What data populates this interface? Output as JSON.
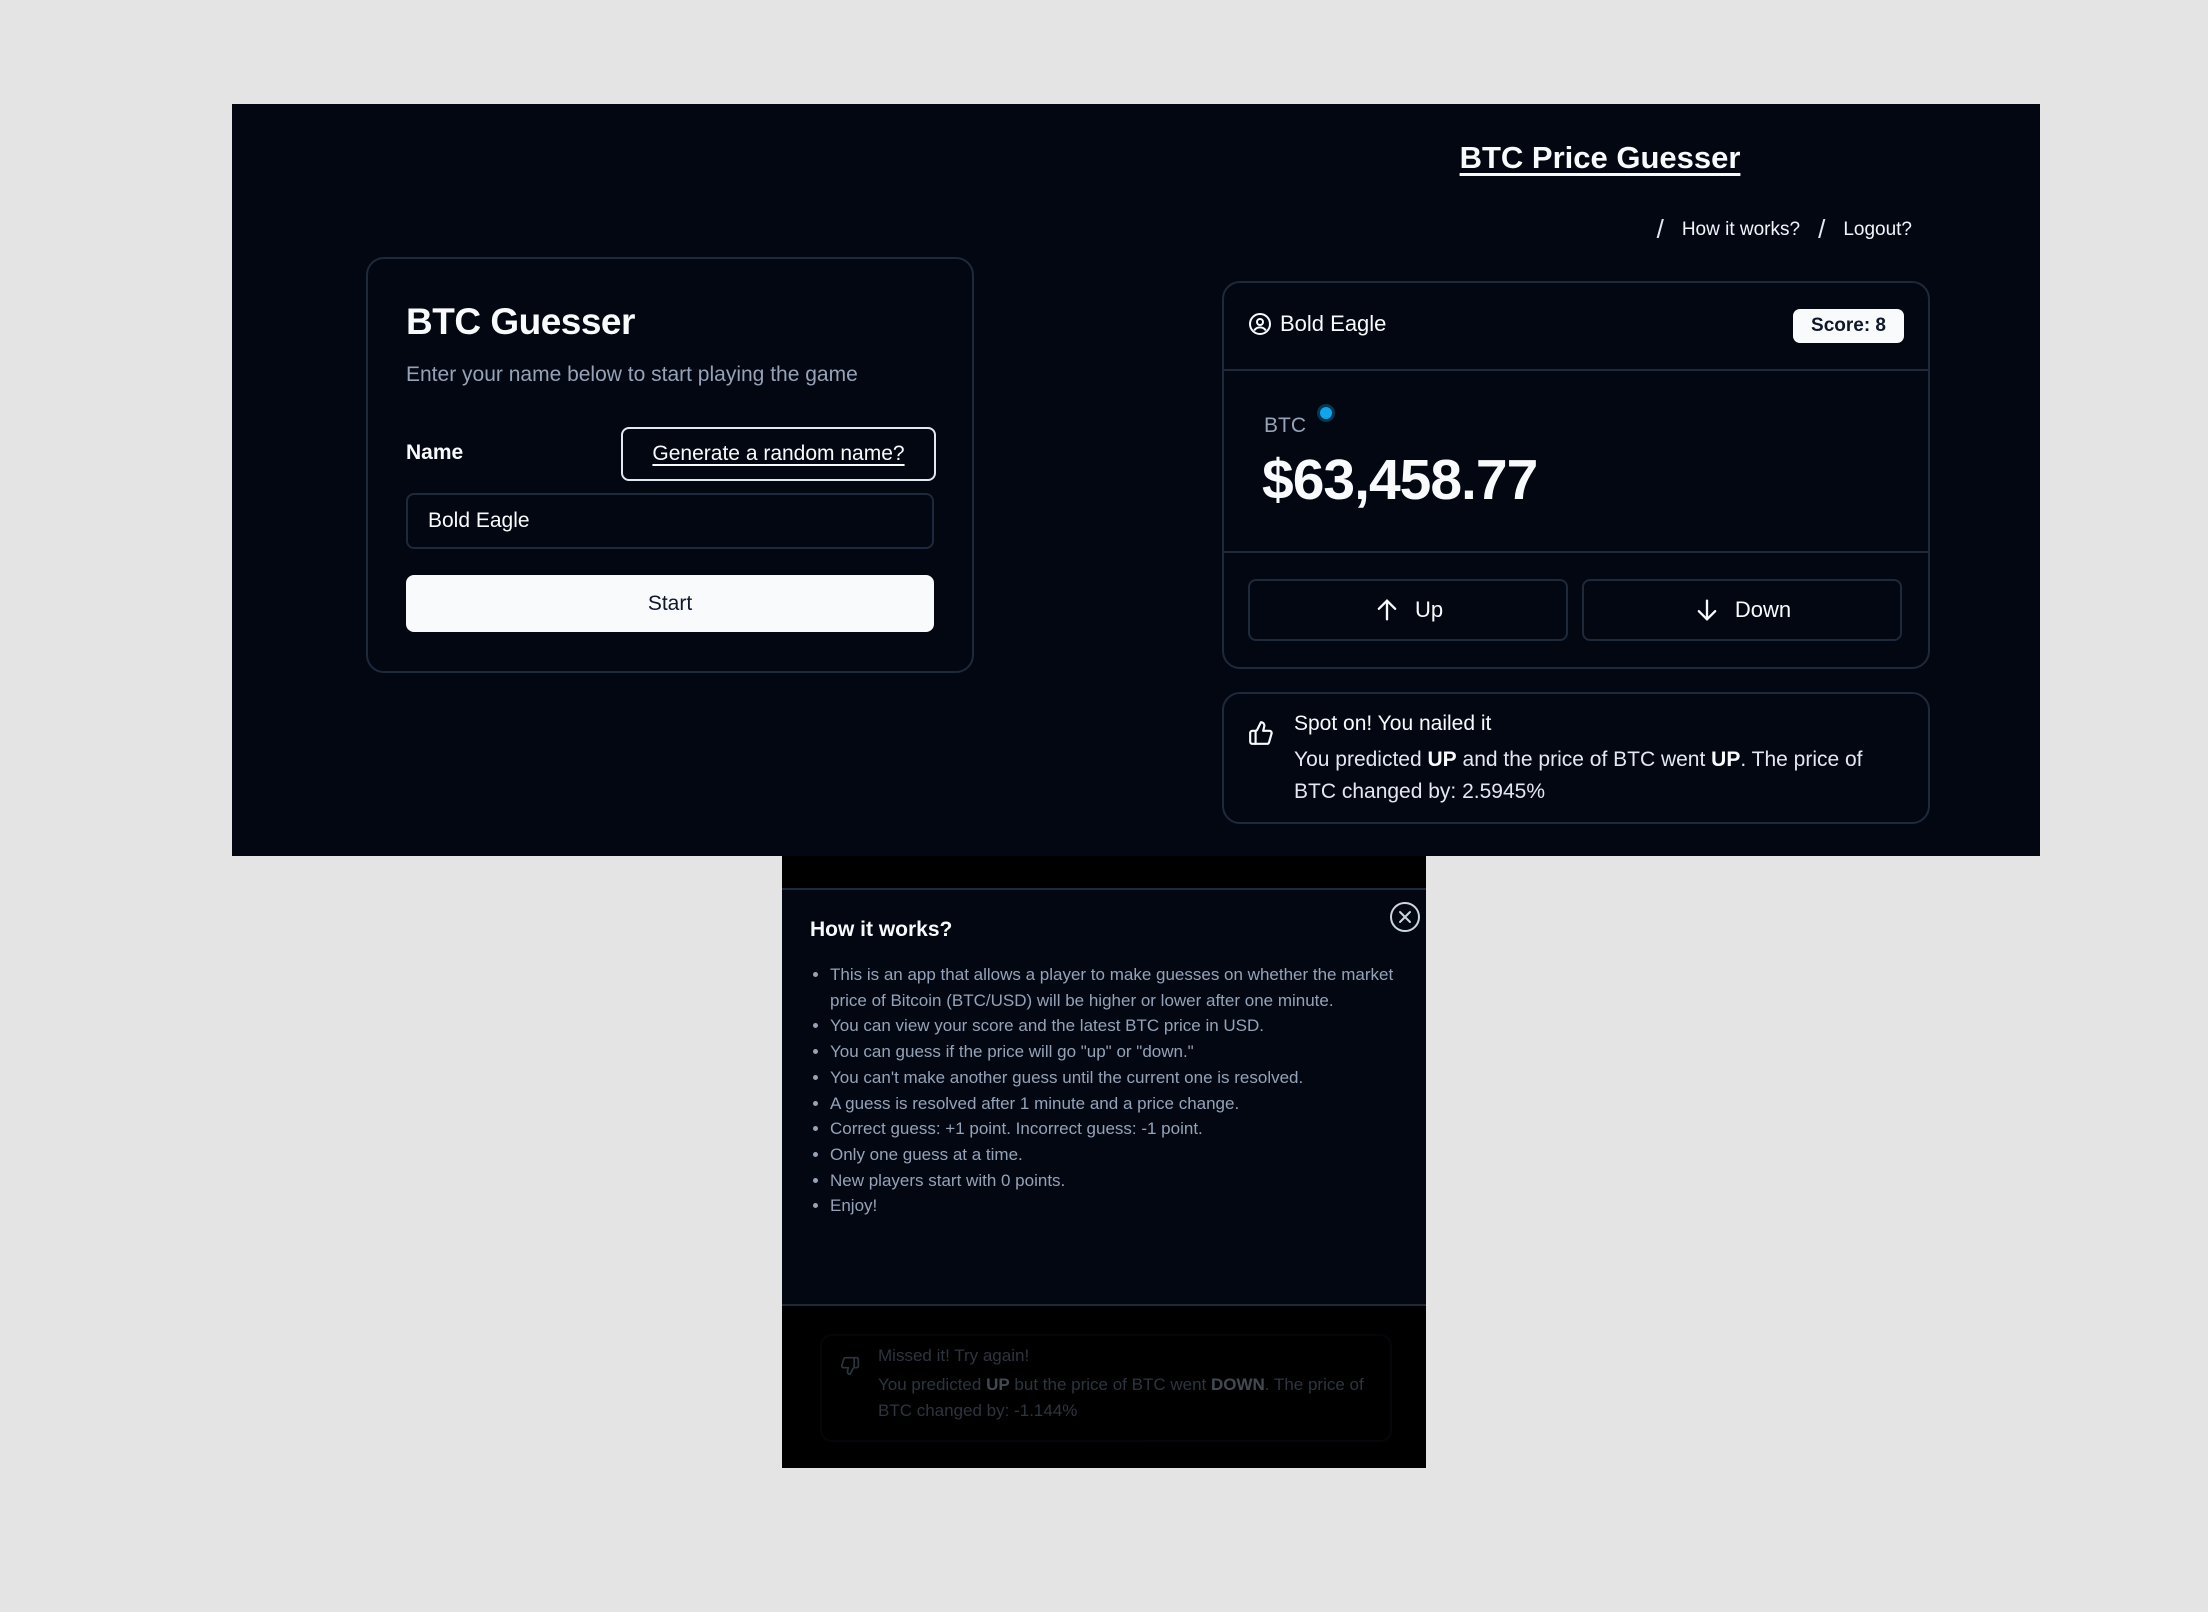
{
  "header": {
    "title": "BTC Price Guesser",
    "nav": [
      {
        "separator": "/",
        "label": "How it works?"
      },
      {
        "separator": "/",
        "label": "Logout?"
      }
    ]
  },
  "login_card": {
    "title": "BTC Guesser",
    "subtitle": "Enter your name below to start playing the game",
    "name_label": "Name",
    "random_name_button": "Generate a random name?",
    "name_value": "Bold Eagle",
    "start_button": "Start"
  },
  "game_card": {
    "user_name": "Bold Eagle",
    "score": "Score: 8",
    "ticker": "BTC",
    "price": "$63,458.77",
    "up_button": "Up",
    "down_button": "Down"
  },
  "result_alert": {
    "heading": "Spot on! You nailed it",
    "text_1": "You predicted ",
    "prediction": "UP",
    "text_2": " and the price of BTC went ",
    "outcome": "UP",
    "text_3": ". The price of BTC changed by: 2.5945%"
  },
  "how_it_works": {
    "title": "How it works?",
    "items": [
      "This is an app that allows a player to make guesses on whether the market price of Bitcoin (BTC/USD) will be higher or lower after one minute.",
      "You can view your score and the latest BTC price in USD.",
      "You can guess if the price will go \"up\" or \"down.\"",
      "You can't make another guess until the current one is resolved.",
      "A guess is resolved after 1 minute and a price change.",
      "Correct guess: +1 point. Incorrect guess: -1 point.",
      "Only one guess at a time.",
      "New players start with 0 points.",
      "Enjoy!"
    ]
  },
  "faded_alert": {
    "heading": "Missed it! Try again!",
    "text_1": "You predicted ",
    "prediction": "UP",
    "text_2": " but the price of BTC went ",
    "outcome": "DOWN",
    "text_3": ". The price of BTC changed by: -1.144%"
  },
  "colors": {
    "page_background": "#e4e4e5",
    "app_background": "#030712",
    "border": "#1e293b",
    "live_dot": "#0ea5e9"
  },
  "icons": [
    "user-circle-icon",
    "arrow-up-icon",
    "arrow-down-icon",
    "thumbs-up-icon",
    "close-icon",
    "thumbs-down-icon"
  ]
}
